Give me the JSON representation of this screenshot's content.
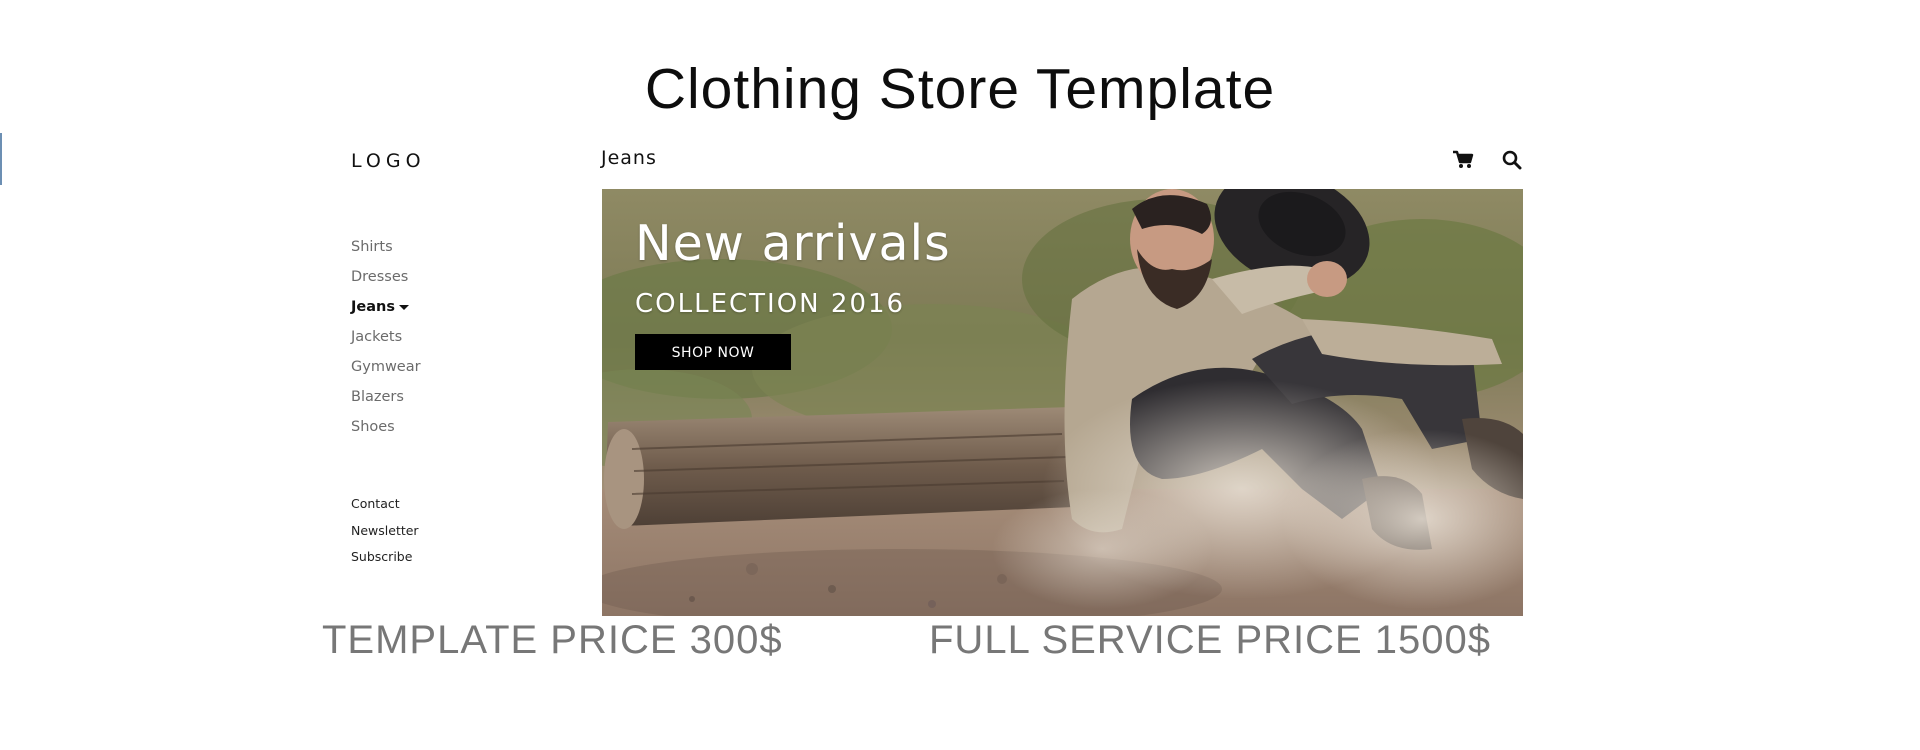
{
  "page_title": "Clothing Store Template",
  "header": {
    "logo": "LOGO",
    "title": "Jeans",
    "icons": [
      "shopping-cart-icon",
      "search-icon"
    ]
  },
  "sidebar": {
    "items": [
      {
        "label": "Shirts",
        "active": false
      },
      {
        "label": "Dresses",
        "active": false
      },
      {
        "label": "Jeans",
        "active": true
      },
      {
        "label": "Jackets",
        "active": false
      },
      {
        "label": "Gymwear",
        "active": false
      },
      {
        "label": "Blazers",
        "active": false
      },
      {
        "label": "Shoes",
        "active": false
      }
    ],
    "links": [
      "Contact",
      "Newsletter",
      "Subscribe"
    ]
  },
  "hero": {
    "heading": "New arrivals",
    "subheading": "COLLECTION 2016",
    "button_label": "SHOP NOW"
  },
  "pricing": {
    "template_price": "TEMPLATE PRICE 300$",
    "full_service_price": "FULL SERVICE PRICE 1500$"
  },
  "colors": {
    "price_text": "#777777",
    "button_bg": "#000000",
    "inactive_nav": "#6b6b6b"
  }
}
